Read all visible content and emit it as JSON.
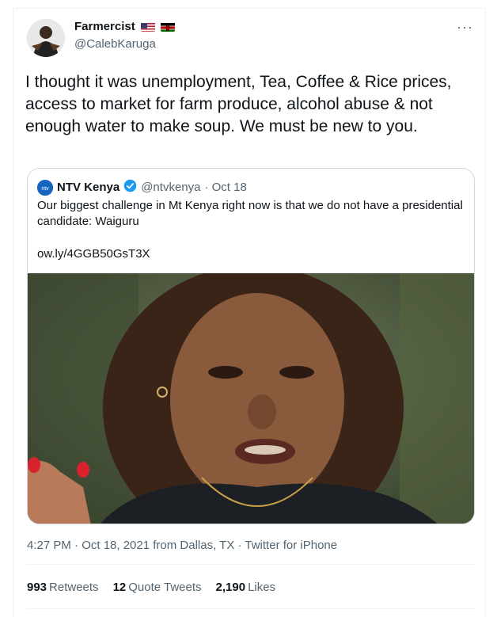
{
  "tweet": {
    "author_name": "Farmercist",
    "author_handle": "@CalebKaruga",
    "more_label": "···",
    "text": "I thought it was unemployment, Tea, Coffee & Rice prices, access to market for farm produce, alcohol abuse & not enough water to make soup. We must be new to you.",
    "timestamp": "4:27 PM · Oct 18, 2021 from Dallas, TX · Twitter for iPhone"
  },
  "quoted": {
    "author_name": "NTV Kenya",
    "author_handle": "@ntvkenya",
    "date": "· Oct 18",
    "logo_text": "ntv",
    "text": "Our biggest challenge in Mt Kenya right now is that we do not have a presidential candidate: Waiguru",
    "link": "ow.ly/4GGB50GsT3X"
  },
  "stats": {
    "retweets_count": "993",
    "retweets_label": "Retweets",
    "quotes_count": "12",
    "quotes_label": "Quote Tweets",
    "likes_count": "2,190",
    "likes_label": "Likes"
  },
  "colors": {
    "verified": "#1d9bf0",
    "secondary_text": "#536471"
  },
  "icons": [
    "us-flag-icon",
    "kenya-flag-icon",
    "more-icon",
    "verified-badge-icon"
  ]
}
